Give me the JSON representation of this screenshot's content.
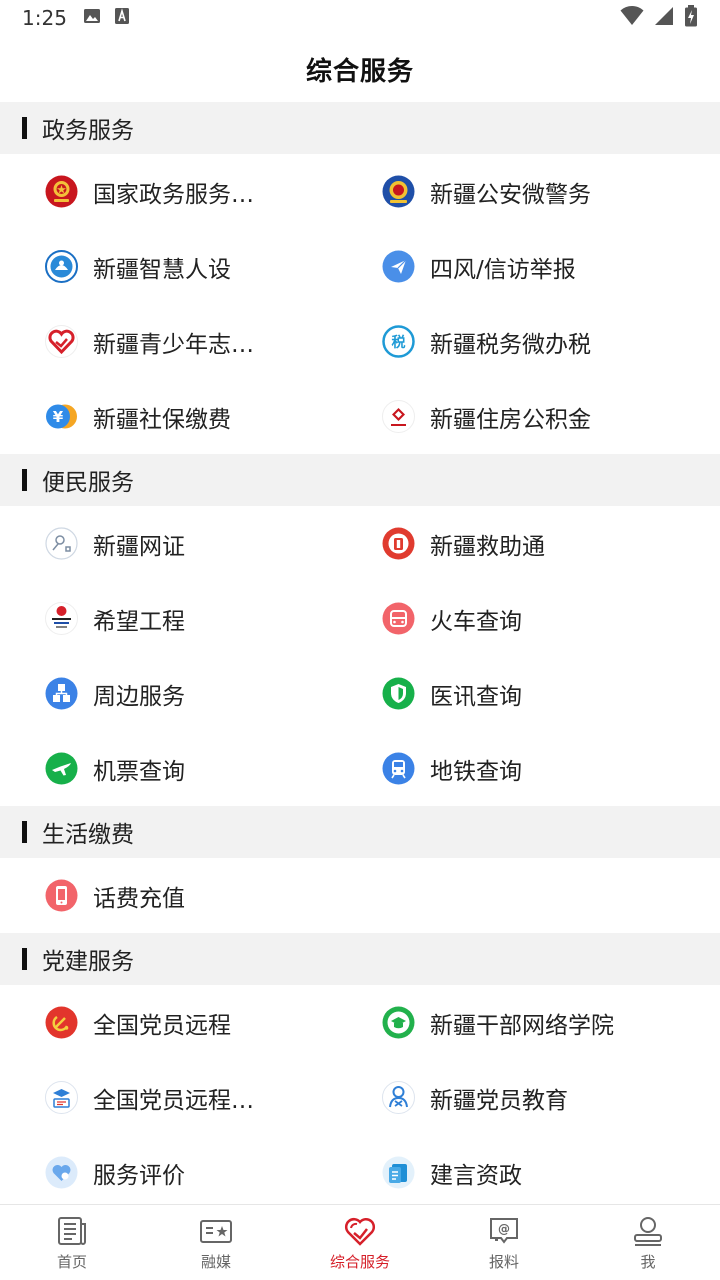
{
  "status_bar": {
    "time": "1:25"
  },
  "header": {
    "title": "综合服务"
  },
  "sections": [
    {
      "title": "政务服务",
      "items": [
        {
          "label": "国家政务服务平台",
          "icon": "national-emblem-icon"
        },
        {
          "label": "新疆公安微警务",
          "icon": "police-badge-icon"
        },
        {
          "label": "新疆智慧人设",
          "icon": "hr-seal-icon"
        },
        {
          "label": "四风/信访举报",
          "icon": "paper-plane-icon"
        },
        {
          "label": "新疆青少年志愿…",
          "icon": "heart-hand-icon"
        },
        {
          "label": "新疆税务微办税",
          "icon": "tax-icon"
        },
        {
          "label": "新疆社保缴费",
          "icon": "yuan-coin-icon"
        },
        {
          "label": "新疆住房公积金",
          "icon": "housing-fund-icon"
        }
      ]
    },
    {
      "title": "便民服务",
      "items": [
        {
          "label": "新疆网证",
          "icon": "id-card-icon"
        },
        {
          "label": "新疆救助通",
          "icon": "relief-icon"
        },
        {
          "label": "希望工程",
          "icon": "hope-project-icon"
        },
        {
          "label": "火车查询",
          "icon": "train-icon"
        },
        {
          "label": "周边服务",
          "icon": "nearby-icon"
        },
        {
          "label": "医讯查询",
          "icon": "medical-shield-icon"
        },
        {
          "label": "机票查询",
          "icon": "airplane-icon"
        },
        {
          "label": "地铁查询",
          "icon": "metro-icon"
        }
      ]
    },
    {
      "title": "生活缴费",
      "items": [
        {
          "label": "话费充值",
          "icon": "phone-icon"
        }
      ]
    },
    {
      "title": "党建服务",
      "items": [
        {
          "label": "全国党员远程",
          "icon": "party-emblem-icon"
        },
        {
          "label": "新疆干部网络学院",
          "icon": "graduation-cap-icon"
        },
        {
          "label": "全国党员远程教育",
          "icon": "remote-education-icon"
        },
        {
          "label": "新疆党员教育",
          "icon": "member-education-icon"
        },
        {
          "label": "服务评价",
          "icon": "rating-heart-icon"
        },
        {
          "label": "建言资政",
          "icon": "suggestion-icon"
        }
      ]
    }
  ],
  "tabbar": {
    "items": [
      {
        "label": "首页",
        "icon": "news-icon"
      },
      {
        "label": "融媒",
        "icon": "media-icon"
      },
      {
        "label": "综合服务",
        "icon": "services-heart-icon"
      },
      {
        "label": "报料",
        "icon": "report-icon"
      },
      {
        "label": "我",
        "icon": "user-icon"
      }
    ],
    "active_index": 2
  },
  "colors": {
    "accent": "#d6202a",
    "section_bg": "#f2f2f2",
    "text": "#222222"
  }
}
